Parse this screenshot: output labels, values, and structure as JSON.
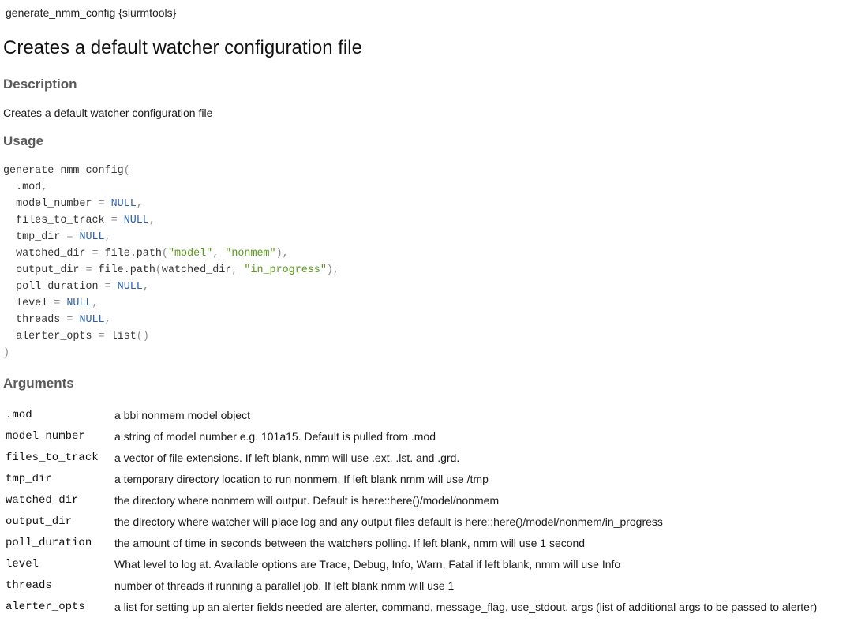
{
  "header": {
    "title": "generate_nmm_config {slurmtools}"
  },
  "page_title": "Creates a default watcher configuration file",
  "description": {
    "heading": "Description",
    "text": "Creates a default watcher configuration file"
  },
  "usage": {
    "heading": "Usage",
    "function_name": "generate_nmm_config",
    "params": [
      {
        "name": ".mod"
      },
      {
        "name": "model_number",
        "default_parts": [
          {
            "t": "NULL",
            "k": "kw"
          }
        ]
      },
      {
        "name": "files_to_track",
        "default_parts": [
          {
            "t": "NULL",
            "k": "kw"
          }
        ]
      },
      {
        "name": "tmp_dir",
        "default_parts": [
          {
            "t": "NULL",
            "k": "kw"
          }
        ]
      },
      {
        "name": "watched_dir",
        "default_parts": [
          {
            "t": "file.path",
            "k": "plain"
          },
          {
            "t": "(",
            "k": "punc"
          },
          {
            "t": "\"model\"",
            "k": "str"
          },
          {
            "t": ", ",
            "k": "punc"
          },
          {
            "t": "\"nonmem\"",
            "k": "str"
          },
          {
            "t": ")",
            "k": "punc"
          }
        ]
      },
      {
        "name": "output_dir",
        "default_parts": [
          {
            "t": "file.path",
            "k": "plain"
          },
          {
            "t": "(",
            "k": "punc"
          },
          {
            "t": "watched_dir",
            "k": "plain"
          },
          {
            "t": ", ",
            "k": "punc"
          },
          {
            "t": "\"in_progress\"",
            "k": "str"
          },
          {
            "t": ")",
            "k": "punc"
          }
        ]
      },
      {
        "name": "poll_duration",
        "default_parts": [
          {
            "t": "NULL",
            "k": "kw"
          }
        ]
      },
      {
        "name": "level",
        "default_parts": [
          {
            "t": "NULL",
            "k": "kw"
          }
        ]
      },
      {
        "name": "threads",
        "default_parts": [
          {
            "t": "NULL",
            "k": "kw"
          }
        ]
      },
      {
        "name": "alerter_opts",
        "default_parts": [
          {
            "t": "list",
            "k": "plain"
          },
          {
            "t": "()",
            "k": "punc"
          }
        ]
      }
    ]
  },
  "arguments": {
    "heading": "Arguments",
    "rows": [
      {
        "name": ".mod",
        "desc": "a bbi nonmem model object"
      },
      {
        "name": "model_number",
        "desc": "a string of model number e.g. 101a15. Default is pulled from .mod"
      },
      {
        "name": "files_to_track",
        "desc": "a vector of file extensions. If left blank, nmm will use .ext, .lst. and .grd."
      },
      {
        "name": "tmp_dir",
        "desc": "a temporary directory location to run nonmem. If left blank nmm will use /tmp"
      },
      {
        "name": "watched_dir",
        "desc": "the directory where nonmem will output. Default is here::here()/model/nonmem"
      },
      {
        "name": "output_dir",
        "desc": "the directory where watcher will place log and any output files default is here::here()/model/nonmem/in_progress"
      },
      {
        "name": "poll_duration",
        "desc": "the amount of time in seconds between the watchers polling. If left blank, nmm will use 1 second"
      },
      {
        "name": "level",
        "desc": "What level to log at. Available options are Trace, Debug, Info, Warn, Fatal if left blank, nmm will use Info"
      },
      {
        "name": "threads",
        "desc": "number of threads if running a parallel job. If left blank nmm will use 1"
      },
      {
        "name": "alerter_opts",
        "desc": "a list for setting up an alerter fields needed are alerter, command, message_flag, use_stdout, args (list of additional args to be passed to alerter)"
      }
    ]
  }
}
